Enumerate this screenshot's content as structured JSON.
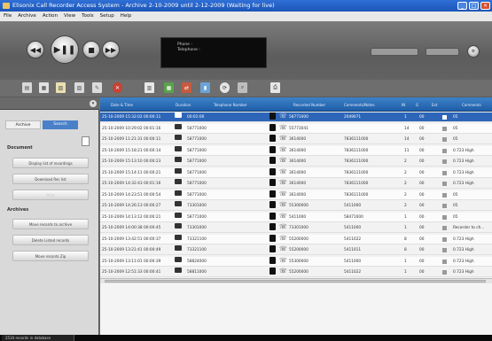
{
  "window": {
    "title": "Elisonix Call Recorder Access System - Archive 2-10-2009 until 2-12-2009 (Waiting for live)"
  },
  "menu": [
    "File",
    "Archive",
    "Action",
    "View",
    "Tools",
    "Setup",
    "Help"
  ],
  "player": {
    "display_line1": "Phone :",
    "display_line2": "Telephone :",
    "slider_label": "00:00",
    "volume_label": ""
  },
  "sidebar": {
    "tabs": [
      "Archive",
      "Search"
    ],
    "sections": [
      {
        "title": "Document",
        "buttons": [
          "Display list of recordings",
          "Download Rec list",
          "Print"
        ]
      },
      {
        "title": "Archives",
        "buttons": [
          "Move records to archive",
          "Delete Listed records",
          "Move records Zip"
        ]
      }
    ]
  },
  "grid": {
    "columns": [
      "Date & Time",
      "Duration",
      "Telephone Number",
      "",
      "",
      "Recorded Number",
      "Comments/Notes",
      "IN",
      "G",
      "Ext",
      "Comments"
    ],
    "rows": [
      {
        "datetime": "25-10-2009 15:32:02 00:00:11",
        "duration": "00:01:00",
        "telephone": "58771000",
        "recorded": "2049071",
        "channel": "1",
        "slot": "00",
        "note": "05"
      },
      {
        "datetime": "25-10-2009 10:29:02 00:01:16",
        "duration": "58771000",
        "telephone": "55773041",
        "recorded": "",
        "channel": "14",
        "slot": "00",
        "note": "05"
      },
      {
        "datetime": "25-10-2009 11:21:31 00:00:11",
        "duration": "58771000",
        "telephone": "3614000",
        "recorded": "7836111000",
        "channel": "14",
        "slot": "00",
        "note": "05"
      },
      {
        "datetime": "25-10-2009 15:18:21 00:00:14",
        "duration": "58771000",
        "telephone": "3614000",
        "recorded": "7836111000",
        "channel": "11",
        "slot": "00",
        "note": "0.723 High"
      },
      {
        "datetime": "25-10-2009 15:13:10 00:00:23",
        "duration": "58771000",
        "telephone": "3614000",
        "recorded": "7836111000",
        "channel": "2",
        "slot": "00",
        "note": "0.723 High"
      },
      {
        "datetime": "25-10-2009 15:14:11 00:00:21",
        "duration": "58771000",
        "telephone": "3614000",
        "recorded": "7836111000",
        "channel": "2",
        "slot": "00",
        "note": "0.723 High"
      },
      {
        "datetime": "25-10-2009 14:32:43 00:01:16",
        "duration": "58771000",
        "telephone": "3614000",
        "recorded": "7836111000",
        "channel": "2",
        "slot": "00",
        "note": "0.723 High"
      },
      {
        "datetime": "25-10-2009 14:23:51 00:00:54",
        "duration": "58771000",
        "telephone": "3614000",
        "recorded": "7836111000",
        "channel": "2",
        "slot": "00",
        "note": "05"
      },
      {
        "datetime": "25-10-2009 14:26:13 00:00:27",
        "duration": "73301000",
        "telephone": "55300000",
        "recorded": "5411000",
        "channel": "2",
        "slot": "00",
        "note": "05"
      },
      {
        "datetime": "25-10-2009 14:13:12 00:00:21",
        "duration": "58771000",
        "telephone": "5411000",
        "recorded": "58471000",
        "channel": "1",
        "slot": "00",
        "note": "05"
      },
      {
        "datetime": "25-10-2009 14:00:38 00:00:45",
        "duration": "73301000",
        "telephone": "73301000",
        "recorded": "5411000",
        "channel": "1",
        "slot": "00",
        "note": "Recorder to ch..."
      },
      {
        "datetime": "25-10-2009 13:42:51 00:00:37",
        "duration": "73321100",
        "telephone": "55200000",
        "recorded": "5411022",
        "channel": "8",
        "slot": "00",
        "note": "0.723 High"
      },
      {
        "datetime": "25-10-2009 13:21:41 00:00:49",
        "duration": "73321100",
        "telephone": "55200000",
        "recorded": "5411011",
        "channel": "8",
        "slot": "00",
        "note": "0.723 High"
      },
      {
        "datetime": "25-10-2009 13:11:01 00:00:39",
        "duration": "58824000",
        "telephone": "55300000",
        "recorded": "5411000",
        "channel": "1",
        "slot": "00",
        "note": "0.723 High"
      },
      {
        "datetime": "25-10-2009 12:51:33 00:00:41",
        "duration": "58811000",
        "telephone": "55200000",
        "recorded": "5411022",
        "channel": "1",
        "slot": "00",
        "note": "0.723 High"
      }
    ]
  },
  "status": {
    "text": "2534 records in database"
  },
  "colors": {
    "grid_header": "#2a6db8",
    "selected_row": "#2d66b8",
    "window_title": "#1c55b8"
  }
}
